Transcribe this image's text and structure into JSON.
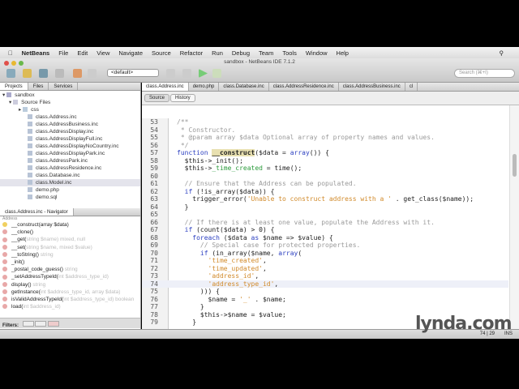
{
  "menu": {
    "app": "NetBeans",
    "items": [
      "File",
      "Edit",
      "View",
      "Navigate",
      "Source",
      "Refactor",
      "Run",
      "Debug",
      "Team",
      "Tools",
      "Window",
      "Help"
    ]
  },
  "window_title": "sandbox - NetBeans IDE 7.1.2",
  "toolbar": {
    "config": "<default>",
    "search_placeholder": "Search (⌘+I)"
  },
  "left_tabs": [
    "Projects",
    "Files",
    "Services"
  ],
  "tree": {
    "project": "sandbox",
    "source": "Source Files",
    "folder": "css",
    "files": [
      "class.Address.inc",
      "class.AddressBusiness.inc",
      "class.AddressDisplay.inc",
      "class.AddressDisplayFull.inc",
      "class.AddressDisplayNoCountry.inc",
      "class.AddressDisplayPark.inc",
      "class.AddressPark.inc",
      "class.AddressResidence.inc",
      "class.Database.inc",
      "class.Model.inc",
      "demo.php",
      "demo.sql"
    ]
  },
  "navigator": {
    "title": "class.Address.inc - Navigator",
    "class": "Address",
    "items": [
      {
        "name": "__construct(array $data)",
        "hint": ""
      },
      {
        "name": "__clone()",
        "hint": ""
      },
      {
        "name": "__get(",
        "hint": "string $name) mixed, null"
      },
      {
        "name": "__set(",
        "hint": "string $name, mixed $value)"
      },
      {
        "name": "__toString()",
        "hint": " string"
      },
      {
        "name": "_init()",
        "hint": ""
      },
      {
        "name": "_postal_code_guess()",
        "hint": " string"
      },
      {
        "name": "_setAddressTypeId(",
        "hint": "int $address_type_id)"
      },
      {
        "name": "display()",
        "hint": " string"
      },
      {
        "name": "getInstance(",
        "hint": "int $address_type_id, array $data)"
      },
      {
        "name": "isValidAddressTypeId(",
        "hint": "int $address_type_id) boolean"
      },
      {
        "name": "load(",
        "hint": "int $address_id)"
      }
    ],
    "filters_label": "Filters:"
  },
  "editor_tabs": [
    "class.Address.inc",
    "demo.php",
    "class.Database.inc",
    "class.AddressResidence.inc",
    "class.AddressBusiness.inc",
    "cl"
  ],
  "editor_toolbar": {
    "source": "Source",
    "history": "History"
  },
  "code": [
    {
      "n": "53",
      "t": [
        [
          "cm",
          "/**"
        ]
      ]
    },
    {
      "n": "54",
      "t": [
        [
          "cm",
          " * Constructor."
        ]
      ]
    },
    {
      "n": "55",
      "t": [
        [
          "cm",
          " * @param array $data Optional array of property names and values."
        ]
      ]
    },
    {
      "n": "56",
      "t": [
        [
          "cm",
          " */"
        ]
      ]
    },
    {
      "n": "57",
      "t": [
        [
          "kw",
          "function "
        ],
        [
          "hl",
          "__construct"
        ],
        [
          "",
          "($data = "
        ],
        [
          "kw",
          "array"
        ],
        [
          "",
          "()) {"
        ]
      ]
    },
    {
      "n": "58",
      "t": [
        [
          "",
          "  $this->_init();"
        ]
      ]
    },
    {
      "n": "59",
      "t": [
        [
          "",
          "  $this->"
        ],
        [
          "pr",
          "_time_created"
        ],
        [
          "",
          " = time();"
        ]
      ]
    },
    {
      "n": "60",
      "t": []
    },
    {
      "n": "61",
      "t": [
        [
          "cm",
          "  // Ensure that the Address can be populated."
        ]
      ]
    },
    {
      "n": "62",
      "t": [
        [
          "kw",
          "  if "
        ],
        [
          "",
          "(!is_array($data)) {"
        ]
      ]
    },
    {
      "n": "63",
      "t": [
        [
          "",
          "    trigger_error("
        ],
        [
          "st",
          "'Unable to construct address with a '"
        ],
        [
          "",
          " . get_class($name));"
        ]
      ]
    },
    {
      "n": "64",
      "t": [
        [
          "",
          "  }"
        ]
      ]
    },
    {
      "n": "65",
      "t": []
    },
    {
      "n": "66",
      "t": [
        [
          "cm",
          "  // If there is at least one value, populate the Address with it."
        ]
      ]
    },
    {
      "n": "67",
      "t": [
        [
          "kw",
          "  if "
        ],
        [
          "",
          "(count($data) > 0) {"
        ]
      ]
    },
    {
      "n": "68",
      "t": [
        [
          "kw",
          "    foreach "
        ],
        [
          "",
          "($data "
        ],
        [
          "kw",
          "as"
        ],
        [
          "",
          " $name => $value) {"
        ]
      ]
    },
    {
      "n": "69",
      "t": [
        [
          "cm",
          "      // Special case for protected properties."
        ]
      ]
    },
    {
      "n": "70",
      "t": [
        [
          "kw",
          "      if "
        ],
        [
          "",
          "(in_array($name, "
        ],
        [
          "kw",
          "array"
        ],
        [
          "",
          "("
        ]
      ]
    },
    {
      "n": "71",
      "t": [
        [
          "st",
          "        'time_created'"
        ],
        [
          "",
          ","
        ]
      ]
    },
    {
      "n": "72",
      "t": [
        [
          "st",
          "        'time_updated'"
        ],
        [
          "",
          ","
        ]
      ]
    },
    {
      "n": "73",
      "t": [
        [
          "st",
          "        'address_id'"
        ],
        [
          "",
          ","
        ]
      ]
    },
    {
      "n": "74",
      "t": [
        [
          "st",
          "        'address_type_id'"
        ],
        [
          "",
          ","
        ]
      ],
      "current": true
    },
    {
      "n": "75",
      "t": [
        [
          "",
          "      ))) {"
        ]
      ]
    },
    {
      "n": "76",
      "t": [
        [
          "",
          "        $name = "
        ],
        [
          "st",
          "'_'"
        ],
        [
          "",
          " . $name;"
        ]
      ]
    },
    {
      "n": "77",
      "t": [
        [
          "",
          "      }"
        ]
      ]
    },
    {
      "n": "78",
      "t": [
        [
          "",
          "      $this->$name = $value;"
        ]
      ]
    },
    {
      "n": "79",
      "t": [
        [
          "",
          "    }"
        ]
      ]
    }
  ],
  "status": {
    "position": "74 | 29",
    "mode": "INS"
  },
  "watermark": "lynda.com"
}
